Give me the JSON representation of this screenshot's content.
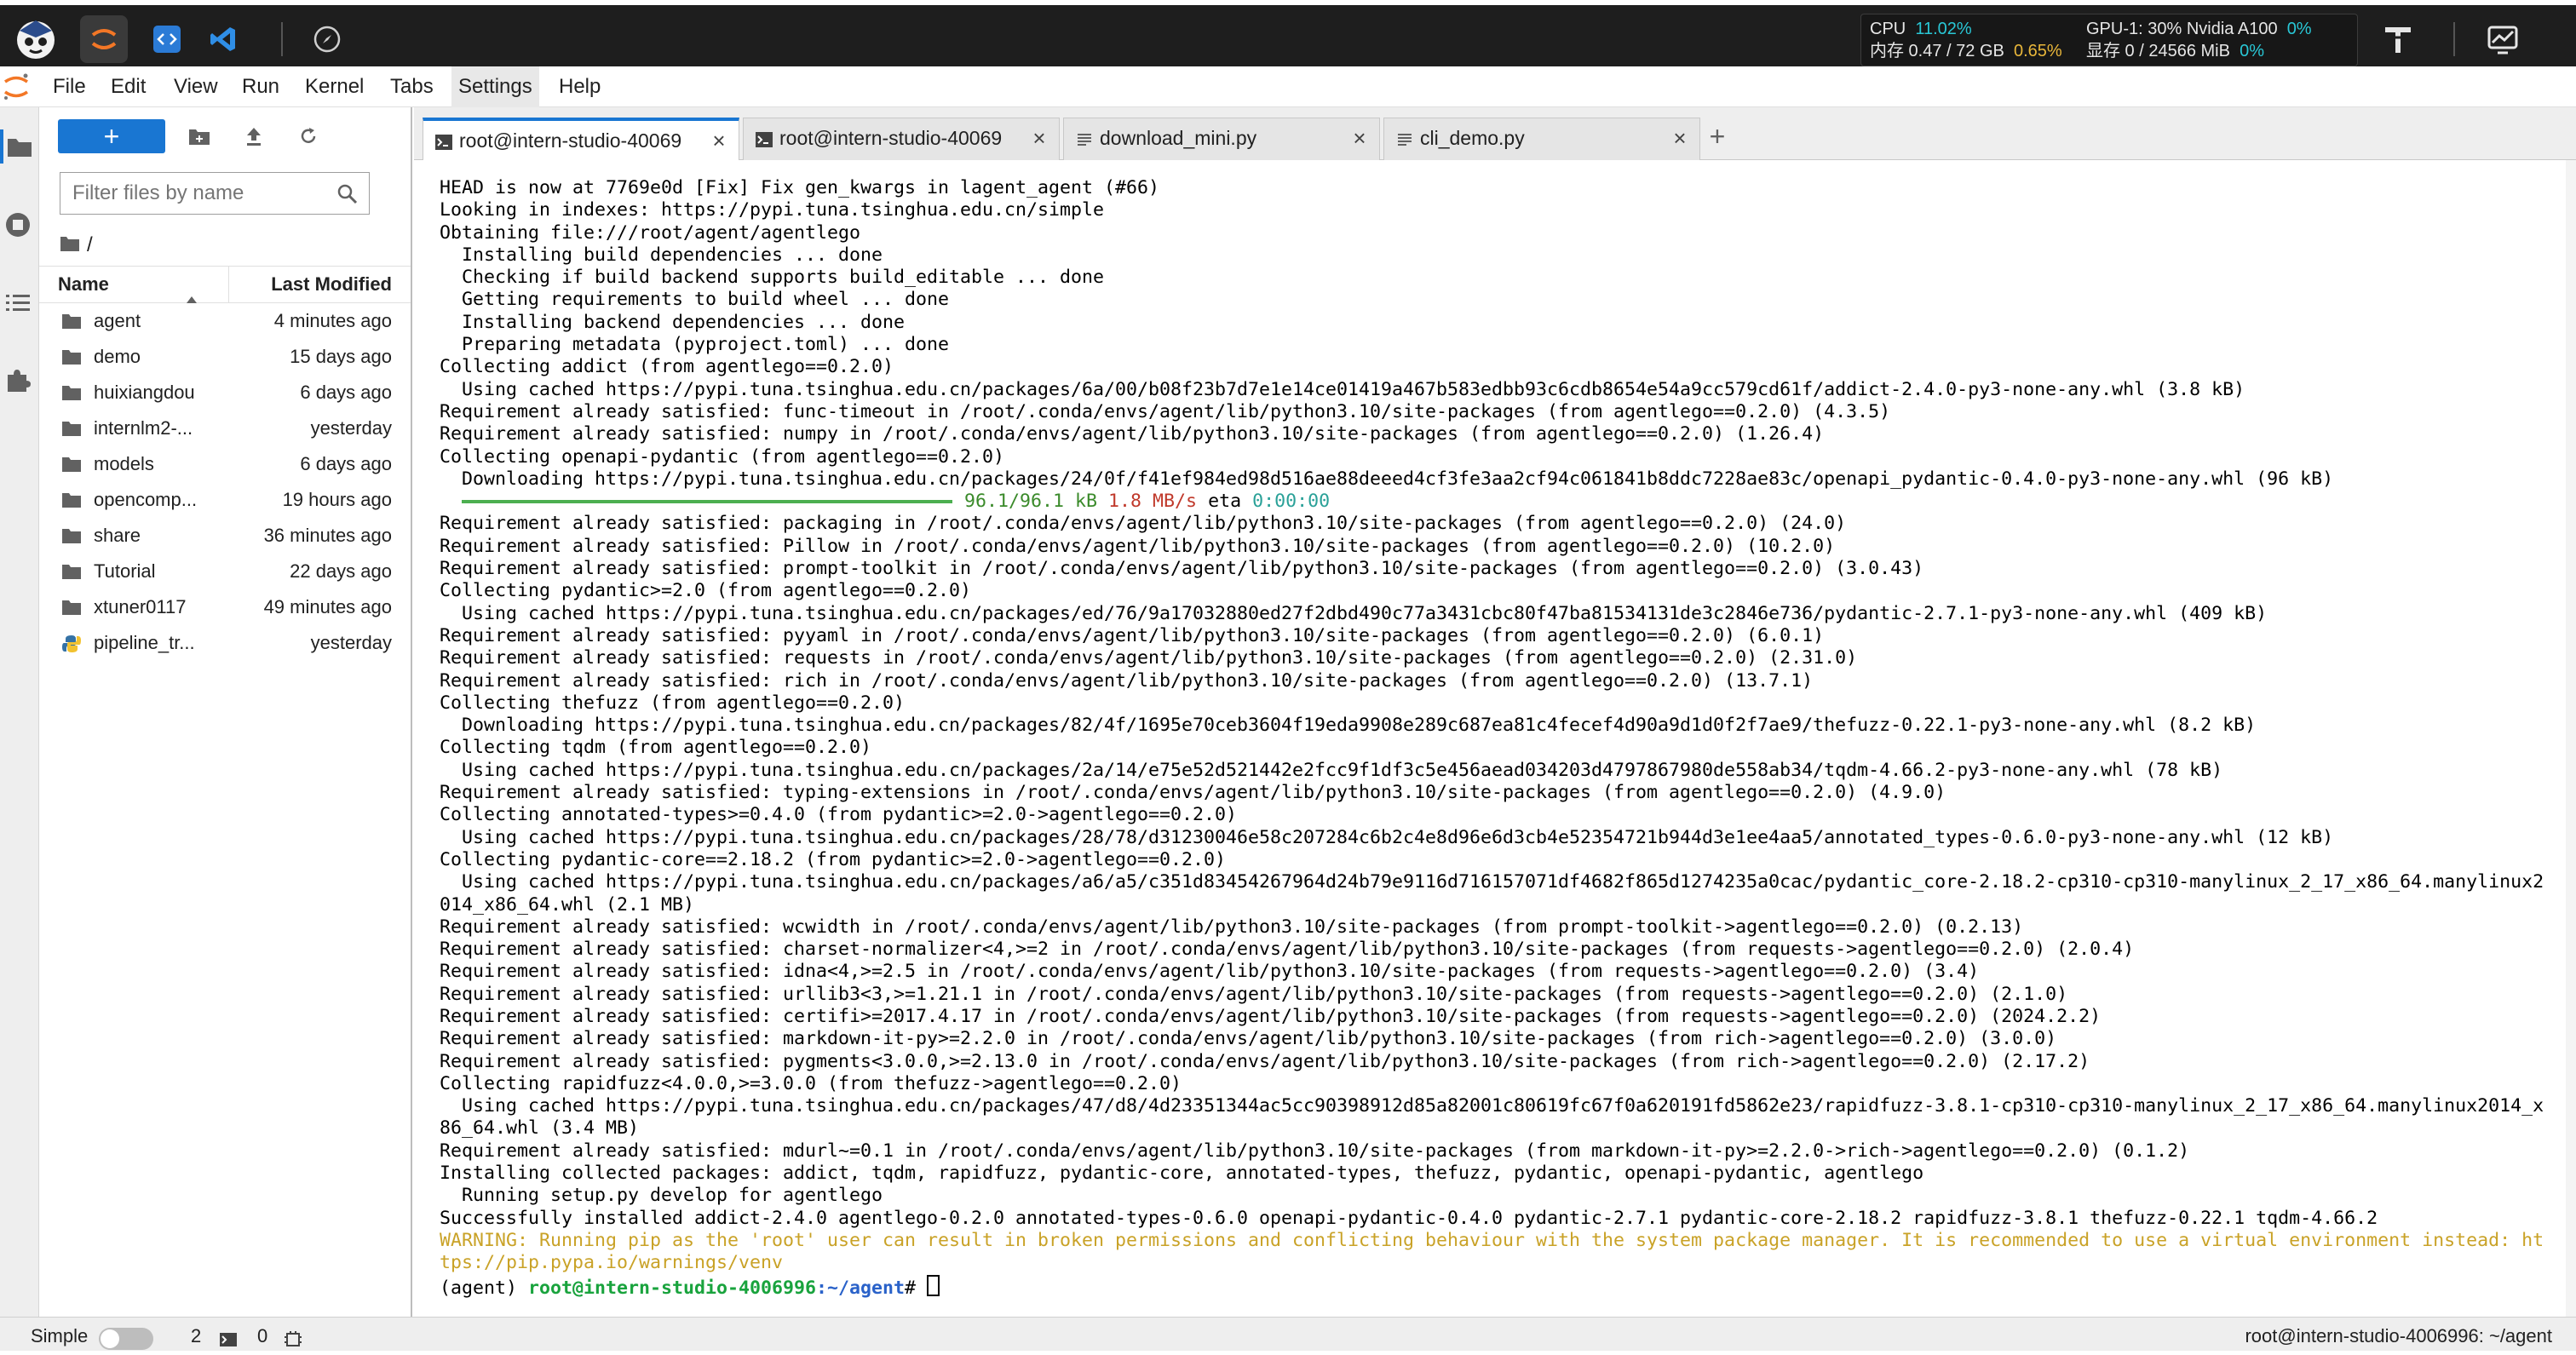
{
  "topbar": {
    "resources": {
      "cpu_label": "CPU",
      "cpu_value": "11.02%",
      "mem_label": "内存 0.47 / 72 GB",
      "mem_value": "0.65%",
      "gpu_label": "GPU-1: 30% Nvidia A100",
      "gpu_value": "0%",
      "vram_label": "显存 0 / 24566 MiB",
      "vram_value": "0%"
    }
  },
  "menubar": {
    "items": [
      "File",
      "Edit",
      "View",
      "Run",
      "Kernel",
      "Tabs",
      "Settings",
      "Help"
    ]
  },
  "filebrowser": {
    "new_label": "+",
    "filter_placeholder": "Filter files by name",
    "breadcrumb": "/",
    "col_name": "Name",
    "col_modified": "Last Modified",
    "files": [
      {
        "name": "agent",
        "modified": "4 minutes ago",
        "type": "folder"
      },
      {
        "name": "demo",
        "modified": "15 days ago",
        "type": "folder"
      },
      {
        "name": "huixiangdou",
        "modified": "6 days ago",
        "type": "folder"
      },
      {
        "name": "internlm2-...",
        "modified": "yesterday",
        "type": "folder"
      },
      {
        "name": "models",
        "modified": "6 days ago",
        "type": "folder"
      },
      {
        "name": "opencomp...",
        "modified": "19 hours ago",
        "type": "folder"
      },
      {
        "name": "share",
        "modified": "36 minutes ago",
        "type": "folder"
      },
      {
        "name": "Tutorial",
        "modified": "22 days ago",
        "type": "folder"
      },
      {
        "name": "xtuner0117",
        "modified": "49 minutes ago",
        "type": "folder"
      },
      {
        "name": "pipeline_tr...",
        "modified": "yesterday",
        "type": "python"
      }
    ]
  },
  "tabs": [
    {
      "label": "root@intern-studio-40069",
      "type": "terminal",
      "active": true
    },
    {
      "label": "root@intern-studio-40069",
      "type": "terminal",
      "active": false
    },
    {
      "label": "download_mini.py",
      "type": "file",
      "active": false
    },
    {
      "label": "cli_demo.py",
      "type": "file",
      "active": false
    }
  ],
  "terminal": {
    "lines": [
      "HEAD is now at 7769e0d [Fix] Fix gen_kwargs in lagent_agent (#66)",
      "Looking in indexes: https://pypi.tuna.tsinghua.edu.cn/simple",
      "Obtaining file:///root/agent/agentlego",
      "  Installing build dependencies ... done",
      "  Checking if build backend supports build_editable ... done",
      "  Getting requirements to build wheel ... done",
      "  Installing backend dependencies ... done",
      "  Preparing metadata (pyproject.toml) ... done",
      "Collecting addict (from agentlego==0.2.0)",
      "  Using cached https://pypi.tuna.tsinghua.edu.cn/packages/6a/00/b08f23b7d7e1e14ce01419a467b583edbb93c6cdb8654e54a9cc579cd61f/addict-2.4.0-py3-none-any.whl (3.8 kB)",
      "Requirement already satisfied: func-timeout in /root/.conda/envs/agent/lib/python3.10/site-packages (from agentlego==0.2.0) (4.3.5)",
      "Requirement already satisfied: numpy in /root/.conda/envs/agent/lib/python3.10/site-packages (from agentlego==0.2.0) (1.26.4)",
      "Collecting openapi-pydantic (from agentlego==0.2.0)",
      "  Downloading https://pypi.tuna.tsinghua.edu.cn/packages/24/0f/f41ef984ed98d516ae88deeed4cf3fe3aa2cf94c061841b8ddc7228ae83c/openapi_pydantic-0.4.0-py3-none-any.whl (96 kB)",
      "__PROGRESS__",
      "Requirement already satisfied: packaging in /root/.conda/envs/agent/lib/python3.10/site-packages (from agentlego==0.2.0) (24.0)",
      "Requirement already satisfied: Pillow in /root/.conda/envs/agent/lib/python3.10/site-packages (from agentlego==0.2.0) (10.2.0)",
      "Requirement already satisfied: prompt-toolkit in /root/.conda/envs/agent/lib/python3.10/site-packages (from agentlego==0.2.0) (3.0.43)",
      "Collecting pydantic>=2.0 (from agentlego==0.2.0)",
      "  Using cached https://pypi.tuna.tsinghua.edu.cn/packages/ed/76/9a17032880ed27f2dbd490c77a3431cbc80f47ba81534131de3c2846e736/pydantic-2.7.1-py3-none-any.whl (409 kB)",
      "Requirement already satisfied: pyyaml in /root/.conda/envs/agent/lib/python3.10/site-packages (from agentlego==0.2.0) (6.0.1)",
      "Requirement already satisfied: requests in /root/.conda/envs/agent/lib/python3.10/site-packages (from agentlego==0.2.0) (2.31.0)",
      "Requirement already satisfied: rich in /root/.conda/envs/agent/lib/python3.10/site-packages (from agentlego==0.2.0) (13.7.1)",
      "Collecting thefuzz (from agentlego==0.2.0)",
      "  Downloading https://pypi.tuna.tsinghua.edu.cn/packages/82/4f/1695e70ceb3604f19eda9908e289c687ea81c4fecef4d90a9d1d0f2f7ae9/thefuzz-0.22.1-py3-none-any.whl (8.2 kB)",
      "Collecting tqdm (from agentlego==0.2.0)",
      "  Using cached https://pypi.tuna.tsinghua.edu.cn/packages/2a/14/e75e52d521442e2fcc9f1df3c5e456aead034203d4797867980de558ab34/tqdm-4.66.2-py3-none-any.whl (78 kB)",
      "Requirement already satisfied: typing-extensions in /root/.conda/envs/agent/lib/python3.10/site-packages (from agentlego==0.2.0) (4.9.0)",
      "Collecting annotated-types>=0.4.0 (from pydantic>=2.0->agentlego==0.2.0)",
      "  Using cached https://pypi.tuna.tsinghua.edu.cn/packages/28/78/d31230046e58c207284c6b2c4e8d96e6d3cb4e52354721b944d3e1ee4aa5/annotated_types-0.6.0-py3-none-any.whl (12 kB)",
      "Collecting pydantic-core==2.18.2 (from pydantic>=2.0->agentlego==0.2.0)",
      "  Using cached https://pypi.tuna.tsinghua.edu.cn/packages/a6/a5/c351d83454267964d24b79e9116d716157071df4682f865d1274235a0cac/pydantic_core-2.18.2-cp310-cp310-manylinux_2_17_x86_64.manylinux2",
      "014_x86_64.whl (2.1 MB)",
      "Requirement already satisfied: wcwidth in /root/.conda/envs/agent/lib/python3.10/site-packages (from prompt-toolkit->agentlego==0.2.0) (0.2.13)",
      "Requirement already satisfied: charset-normalizer<4,>=2 in /root/.conda/envs/agent/lib/python3.10/site-packages (from requests->agentlego==0.2.0) (2.0.4)",
      "Requirement already satisfied: idna<4,>=2.5 in /root/.conda/envs/agent/lib/python3.10/site-packages (from requests->agentlego==0.2.0) (3.4)",
      "Requirement already satisfied: urllib3<3,>=1.21.1 in /root/.conda/envs/agent/lib/python3.10/site-packages (from requests->agentlego==0.2.0) (2.1.0)",
      "Requirement already satisfied: certifi>=2017.4.17 in /root/.conda/envs/agent/lib/python3.10/site-packages (from requests->agentlego==0.2.0) (2024.2.2)",
      "Requirement already satisfied: markdown-it-py>=2.2.0 in /root/.conda/envs/agent/lib/python3.10/site-packages (from rich->agentlego==0.2.0) (3.0.0)",
      "Requirement already satisfied: pygments<3.0.0,>=2.13.0 in /root/.conda/envs/agent/lib/python3.10/site-packages (from rich->agentlego==0.2.0) (2.17.2)",
      "Collecting rapidfuzz<4.0.0,>=3.0.0 (from thefuzz->agentlego==0.2.0)",
      "  Using cached https://pypi.tuna.tsinghua.edu.cn/packages/47/d8/4d23351344ac5cc90398912d85a82001c80619fc67f0a620191fd5862e23/rapidfuzz-3.8.1-cp310-cp310-manylinux_2_17_x86_64.manylinux2014_x",
      "86_64.whl (3.4 MB)",
      "Requirement already satisfied: mdurl~=0.1 in /root/.conda/envs/agent/lib/python3.10/site-packages (from markdown-it-py>=2.2.0->rich->agentlego==0.2.0) (0.1.2)",
      "Installing collected packages: addict, tqdm, rapidfuzz, pydantic-core, annotated-types, thefuzz, pydantic, openapi-pydantic, agentlego",
      "  Running setup.py develop for agentlego",
      "Successfully installed addict-2.4.0 agentlego-0.2.0 annotated-types-0.6.0 openapi-pydantic-0.4.0 pydantic-2.7.1 pydantic-core-2.18.2 rapidfuzz-3.8.1 thefuzz-0.22.1 tqdm-4.66.2",
      "__WARN1__",
      "__WARN2__",
      "__PROMPT__"
    ],
    "progress": {
      "fraction": 1.0,
      "size": "96.1/96.1 kB",
      "speed": "1.8 MB/s",
      "eta_label": "eta",
      "eta": "0:00:00"
    },
    "warning_line1": "WARNING: Running pip as the 'root' user can result in broken permissions and conflicting behaviour with the system package manager. It is recommended to use a virtual environment instead: ht",
    "warning_line2": "tps://pip.pypa.io/warnings/venv",
    "prompt_env": "(agent) ",
    "prompt_host": "root@intern-studio-4006996",
    "prompt_path": ":~/agent",
    "prompt_symbol": "# "
  },
  "statusbar": {
    "mode_label": "Simple",
    "terminals_count": "2",
    "kernels_count": "0",
    "right_text": "root@intern-studio-4006996: ~/agent"
  }
}
